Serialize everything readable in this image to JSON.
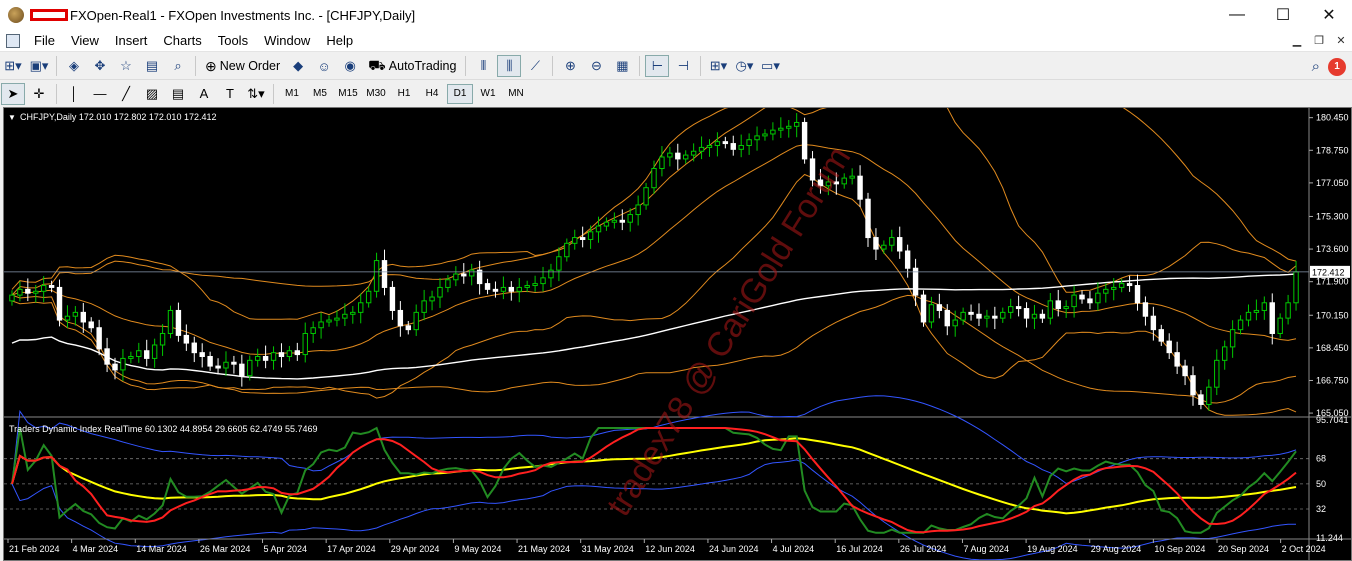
{
  "window": {
    "title": "FXOpen-Real1 - FXOpen Investments Inc. - [CHFJPY,Daily]",
    "minimize": "—",
    "maximize": "☐",
    "close": "✕"
  },
  "menu": [
    "File",
    "View",
    "Insert",
    "Charts",
    "Tools",
    "Window",
    "Help"
  ],
  "toolbar": {
    "new_order": "New Order",
    "autotrading": "AutoTrading"
  },
  "timeframes": [
    "M1",
    "M5",
    "M15",
    "M30",
    "H1",
    "H4",
    "D1",
    "W1",
    "MN"
  ],
  "active_timeframe": "D1",
  "notification_count": "1",
  "chart": {
    "header": "CHFJPY,Daily  172.010 172.802 172.010 172.412",
    "current_price": "172.412",
    "watermark": "tradex78 @ CariGold Forum",
    "indicator_header": "Traders Dynamic Index RealTime 60.1302 44.8954 29.6605 62.4749 55.7469",
    "colors": {
      "bull": "#00c800",
      "bear": "#ffffff",
      "bands": "#e08a1e",
      "ma": "#ffffff",
      "rsi": "#228b22",
      "signal": "#ff2020",
      "base": "#ffff00",
      "vb": "#3355ff"
    }
  },
  "chart_data": {
    "type": "candlestick",
    "title": "CHFJPY,Daily",
    "y_ticks": [
      180.45,
      178.75,
      177.05,
      175.3,
      173.6,
      171.9,
      170.15,
      168.45,
      166.75,
      165.05
    ],
    "ylim": [
      164.95,
      180.85
    ],
    "x_labels": [
      "21 Feb 2024",
      "4 Mar 2024",
      "14 Mar 2024",
      "26 Mar 2024",
      "5 Apr 2024",
      "17 Apr 2024",
      "29 Apr 2024",
      "9 May 2024",
      "21 May 2024",
      "31 May 2024",
      "12 Jun 2024",
      "24 Jun 2024",
      "4 Jul 2024",
      "16 Jul 2024",
      "26 Jul 2024",
      "7 Aug 2024",
      "19 Aug 2024",
      "29 Aug 2024",
      "10 Sep 2024",
      "20 Sep 2024",
      "2 Oct 2024"
    ],
    "closes": [
      171.2,
      171.5,
      171.3,
      171.4,
      171.7,
      171.6,
      169.9,
      170.1,
      170.3,
      169.8,
      169.5,
      168.4,
      167.6,
      167.3,
      167.9,
      168.0,
      168.3,
      167.9,
      168.6,
      169.2,
      170.4,
      169.1,
      168.7,
      168.2,
      168.0,
      167.5,
      167.4,
      167.7,
      167.6,
      167.0,
      167.8,
      168.0,
      167.8,
      168.2,
      168.0,
      168.3,
      168.1,
      169.2,
      169.5,
      169.8,
      169.9,
      170.0,
      170.2,
      170.3,
      170.8,
      171.4,
      173.0,
      171.6,
      170.4,
      169.6,
      169.4,
      170.3,
      170.9,
      171.1,
      171.6,
      172.0,
      172.3,
      172.2,
      172.5,
      171.8,
      171.5,
      171.4,
      171.6,
      171.4,
      171.6,
      171.7,
      171.8,
      172.1,
      172.5,
      173.2,
      173.9,
      174.2,
      174.1,
      174.5,
      174.8,
      175.0,
      175.1,
      175.0,
      175.4,
      175.9,
      176.8,
      177.8,
      178.4,
      178.6,
      178.3,
      178.5,
      178.7,
      178.9,
      179.0,
      179.2,
      179.1,
      178.8,
      179.0,
      179.3,
      179.5,
      179.6,
      179.8,
      179.9,
      180.0,
      180.2,
      178.3,
      177.2,
      176.9,
      177.1,
      177.0,
      177.3,
      177.4,
      176.2,
      174.2,
      173.6,
      173.8,
      174.2,
      173.5,
      172.6,
      171.2,
      169.8,
      170.7,
      170.4,
      169.6,
      169.9,
      170.3,
      170.2,
      170.0,
      170.1,
      170.0,
      170.3,
      170.6,
      170.5,
      170.0,
      170.2,
      170.0,
      170.9,
      170.5,
      170.6,
      171.2,
      171.0,
      170.8,
      171.3,
      171.5,
      171.6,
      171.8,
      171.7,
      170.8,
      170.1,
      169.4,
      168.8,
      168.2,
      167.5,
      167.0,
      166.0,
      165.5,
      166.4,
      167.8,
      168.5,
      169.4,
      169.9,
      170.3,
      170.4,
      170.8,
      169.2,
      170.0,
      170.8,
      172.412
    ]
  }
}
